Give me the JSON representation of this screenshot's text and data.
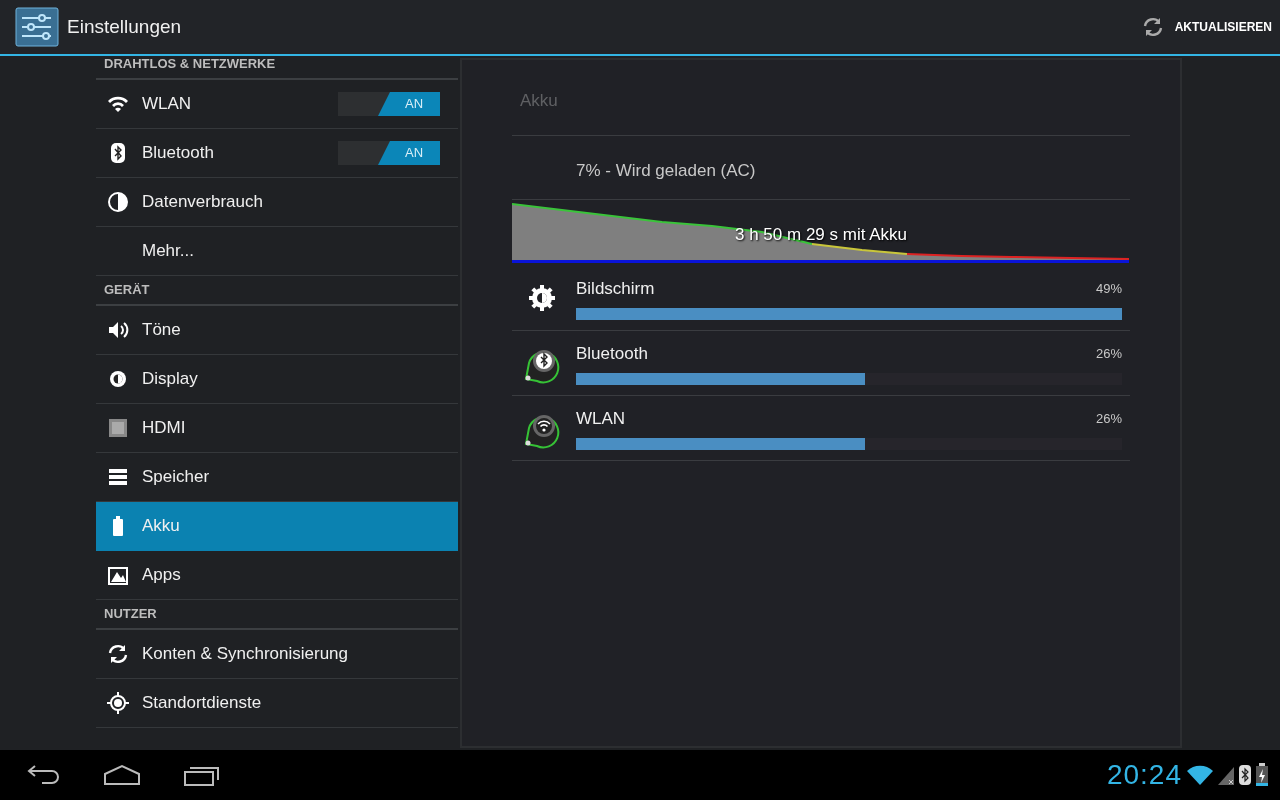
{
  "action_bar": {
    "title": "Einstellungen",
    "action": "AKTUALISIEREN"
  },
  "sidebar": {
    "sections": [
      {
        "header": "DRAHTLOS & NETZWERKE",
        "items": [
          {
            "kind": "wifi",
            "label": "WLAN",
            "selected": false,
            "toggle": {
              "label": "AN",
              "on": true
            }
          },
          {
            "kind": "bluetooth",
            "label": "Bluetooth",
            "selected": false,
            "toggle": {
              "label": "AN",
              "on": true
            }
          },
          {
            "kind": "data",
            "label": "Datenverbrauch",
            "selected": false
          },
          {
            "kind": "none",
            "label": "Mehr...",
            "selected": false
          }
        ]
      },
      {
        "header": "GERÄT",
        "items": [
          {
            "kind": "sound",
            "label": "Töne",
            "selected": false
          },
          {
            "kind": "display",
            "label": "Display",
            "selected": false
          },
          {
            "kind": "hdmi",
            "label": "HDMI",
            "selected": false
          },
          {
            "kind": "storage",
            "label": "Speicher",
            "selected": false
          },
          {
            "kind": "battery",
            "label": "Akku",
            "selected": true
          },
          {
            "kind": "apps",
            "label": "Apps",
            "selected": false
          }
        ]
      },
      {
        "header": "NUTZER",
        "items": [
          {
            "kind": "sync",
            "label": "Konten & Synchronisierung",
            "selected": false
          },
          {
            "kind": "location",
            "label": "Standortdienste",
            "selected": false
          }
        ]
      }
    ]
  },
  "detail": {
    "title": "Akku",
    "status": "7% - Wird geladen (AC)",
    "graph_caption": "3 h 50 m 29 s mit Akku",
    "usage": [
      {
        "kind": "brightness",
        "name": "Bildschirm",
        "percent": "49%",
        "level": 1.0
      },
      {
        "kind": "bluetooth",
        "name": "Bluetooth",
        "percent": "26%",
        "level": 0.53
      },
      {
        "kind": "wifi",
        "name": "WLAN",
        "percent": "26%",
        "level": 0.53
      }
    ]
  },
  "system_bar": {
    "time": "20:24"
  }
}
